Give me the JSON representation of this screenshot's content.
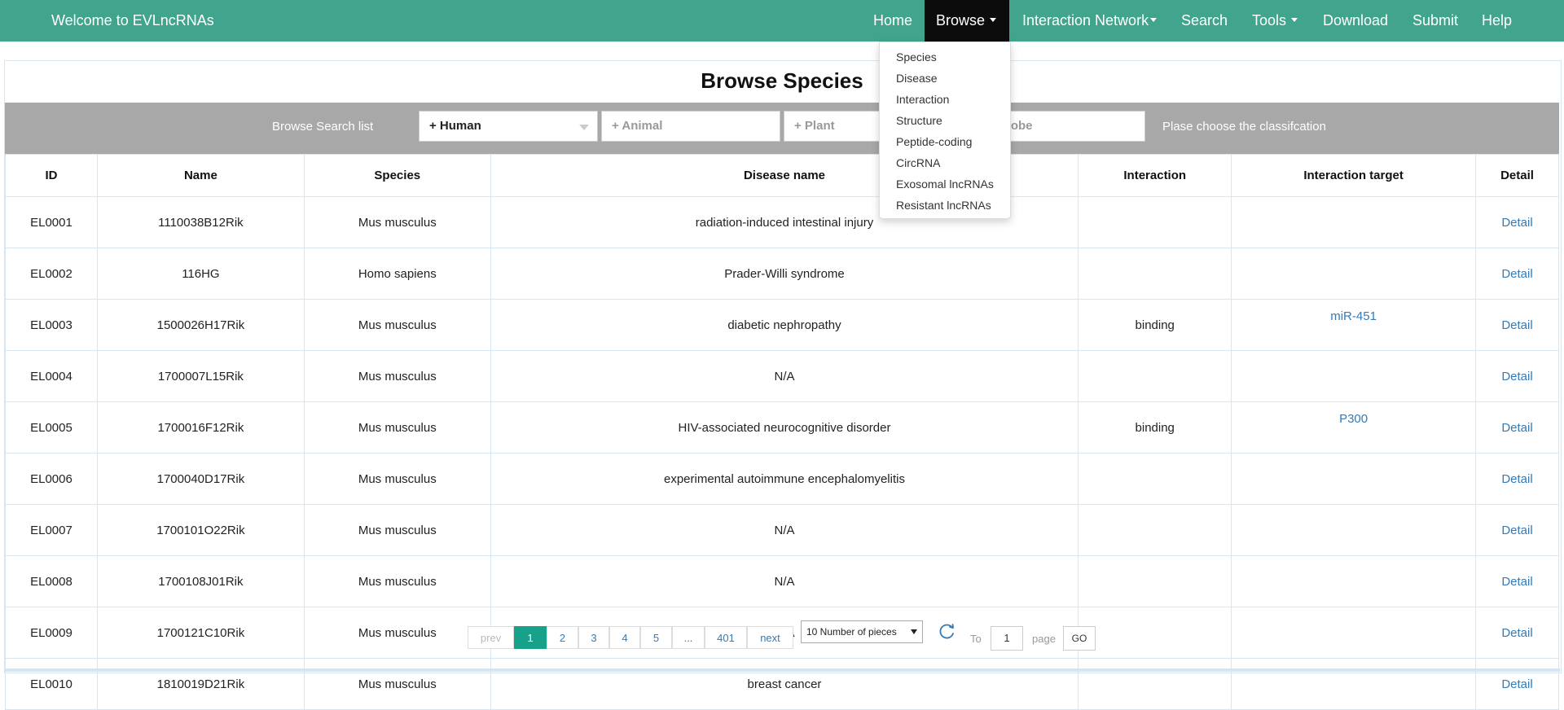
{
  "navbar": {
    "brand": "Welcome to EVLncRNAs",
    "items": [
      {
        "label": "Home"
      },
      {
        "label": "Browse"
      },
      {
        "label": "Interaction Network"
      },
      {
        "label": "Search"
      },
      {
        "label": "Tools"
      },
      {
        "label": "Download"
      },
      {
        "label": "Submit"
      },
      {
        "label": "Help"
      }
    ],
    "bg_color": "#41a48c",
    "active_color": "#0c0c0c"
  },
  "browse_menu": {
    "items": [
      "Species",
      "Disease",
      "Interaction",
      "Structure",
      "Peptide-coding",
      "CircRNA",
      "Exosomal lncRNAs",
      "Resistant lncRNAs"
    ]
  },
  "page_title": "Browse Species",
  "filter": {
    "label": "Browse Search list",
    "selects": [
      "+ Human",
      "+ Animal",
      "+ Plant",
      "robe"
    ],
    "hint": "Plase choose the classifcation"
  },
  "table": {
    "headers": [
      "ID",
      "Name",
      "Species",
      "Disease name",
      "Interaction",
      "Interaction target",
      "Detail"
    ],
    "rows": [
      {
        "id": "EL0001",
        "name": "1110038B12Rik",
        "species": "Mus musculus",
        "disease": "radiation-induced intestinal injury",
        "interaction": "",
        "target": "",
        "detail": "Detail"
      },
      {
        "id": "EL0002",
        "name": "116HG",
        "species": "Homo sapiens",
        "disease": "Prader-Willi syndrome",
        "interaction": "",
        "target": "",
        "detail": "Detail"
      },
      {
        "id": "EL0003",
        "name": "1500026H17Rik",
        "species": "Mus musculus",
        "disease": "diabetic nephropathy",
        "interaction": "binding",
        "target": "miR-451",
        "detail": "Detail"
      },
      {
        "id": "EL0004",
        "name": "1700007L15Rik",
        "species": "Mus musculus",
        "disease": "N/A",
        "interaction": "",
        "target": "",
        "detail": "Detail"
      },
      {
        "id": "EL0005",
        "name": "1700016F12Rik",
        "species": "Mus musculus",
        "disease": "HIV-associated neurocognitive disorder",
        "interaction": "binding",
        "target": "P300",
        "detail": "Detail"
      },
      {
        "id": "EL0006",
        "name": "1700040D17Rik",
        "species": "Mus musculus",
        "disease": "experimental autoimmune encephalomyelitis",
        "interaction": "",
        "target": "",
        "detail": "Detail"
      },
      {
        "id": "EL0007",
        "name": "1700101O22Rik",
        "species": "Mus musculus",
        "disease": "N/A",
        "interaction": "",
        "target": "",
        "detail": "Detail"
      },
      {
        "id": "EL0008",
        "name": "1700108J01Rik",
        "species": "Mus musculus",
        "disease": "N/A",
        "interaction": "",
        "target": "",
        "detail": "Detail"
      },
      {
        "id": "EL0009",
        "name": "1700121C10Rik",
        "species": "Mus musculus",
        "disease": "N/A",
        "interaction": "",
        "target": "",
        "detail": "Detail"
      },
      {
        "id": "EL0010",
        "name": "1810019D21Rik",
        "species": "Mus musculus",
        "disease": "breast cancer",
        "interaction": "",
        "target": "",
        "detail": "Detail"
      }
    ]
  },
  "pagination": {
    "prev": "prev",
    "pages": [
      "1",
      "2",
      "3",
      "4",
      "5",
      "...",
      "401"
    ],
    "next": "next",
    "current_page": "1",
    "page_size": "10 Number of pieces",
    "to_label": "To",
    "goto_value": "1",
    "page_label": "page",
    "go_label": "GO",
    "accent_color": "#17a08a"
  }
}
